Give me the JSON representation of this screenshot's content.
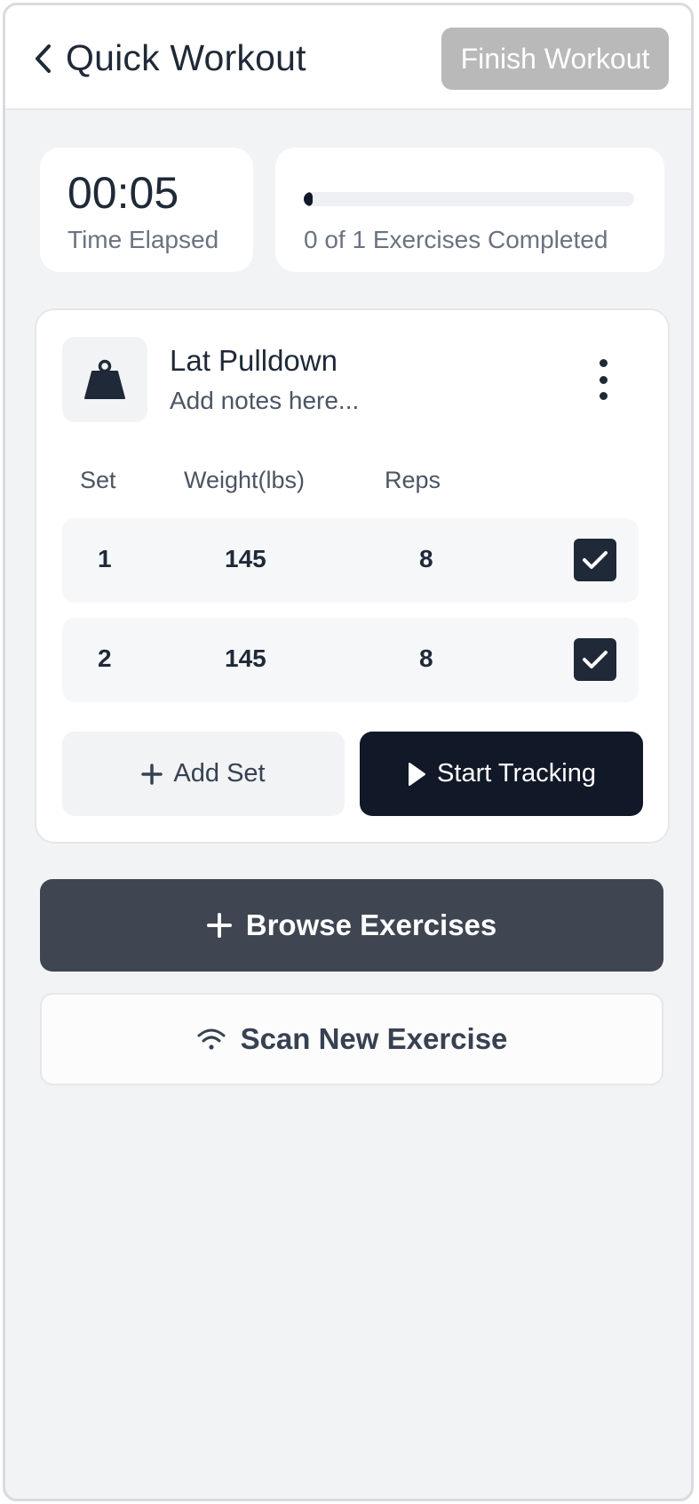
{
  "header": {
    "title": "Quick Workout",
    "finish_label": "Finish Workout"
  },
  "stats": {
    "time_elapsed_value": "00:05",
    "time_elapsed_label": "Time Elapsed",
    "progress_fraction": 0.0,
    "progress_label": "0 of 1 Exercises Completed"
  },
  "exercise": {
    "name": "Lat Pulldown",
    "notes_placeholder": "Add notes here...",
    "columns": [
      "Set",
      "Weight(lbs)",
      "Reps"
    ],
    "sets": [
      {
        "set": "1",
        "weight": "145",
        "reps": "8",
        "checked": true
      },
      {
        "set": "2",
        "weight": "145",
        "reps": "8",
        "checked": true
      }
    ],
    "add_set_label": "Add Set",
    "start_tracking_label": "Start Tracking"
  },
  "actions": {
    "browse_label": "Browse Exercises",
    "scan_label": "Scan New Exercise"
  },
  "icons": {
    "back": "chevron-left-icon",
    "exercise": "weight-icon",
    "more": "more-vertical-icon",
    "check": "check-icon",
    "add": "plus-icon",
    "play": "play-icon",
    "scan": "wifi-icon"
  },
  "colors": {
    "primary_dark": "#111827",
    "browse_bg": "#3f4652",
    "finish_disabled": "#b9b9b9",
    "page_bg": "#f2f3f5"
  }
}
